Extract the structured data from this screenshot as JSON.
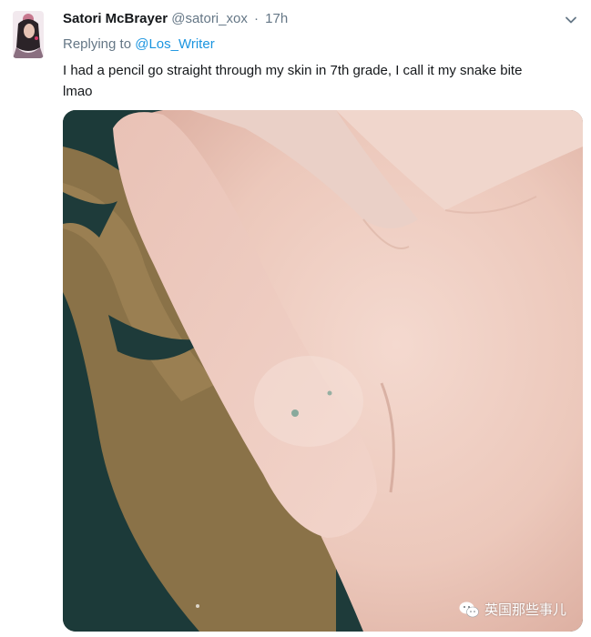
{
  "tweet": {
    "display_name": "Satori McBrayer",
    "handle": "@satori_xox",
    "separator": "·",
    "time": "17h",
    "replying_prefix": "Replying to",
    "replying_to": "@Los_Writer",
    "text_line1": "I had a pencil go straight through my skin in 7th grade, I call it my snake bite",
    "text_line2": "lmao"
  },
  "media": {
    "watermark_text": "英国那些事儿",
    "icon": "wechat-icon"
  },
  "colors": {
    "name": "#14171a",
    "muted": "#657786",
    "link": "#1b95e0"
  },
  "icons": {
    "menu": "chevron-down-icon",
    "avatar": "avatar"
  }
}
